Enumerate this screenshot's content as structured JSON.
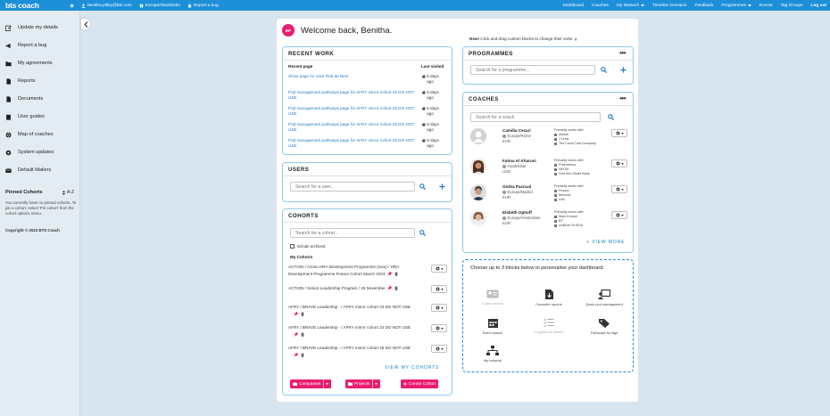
{
  "topbar": {
    "logo_main": "bts",
    "logo_sub": "coach",
    "user_email": "benitha.pilley@bts.com",
    "timezone": "Europe/Stockholm",
    "report_bug": "Report a bug",
    "nav": [
      "Dashboard",
      "Coaches",
      "My Network",
      "Timeline Domains",
      "Feedback",
      "Programmes",
      "Events",
      "Tag Groups"
    ],
    "logout": "Log out"
  },
  "sidebar": {
    "items": [
      {
        "label": "Update my details",
        "icon": "edit-icon"
      },
      {
        "label": "Report a bug",
        "icon": "megaphone-icon"
      },
      {
        "label": "My agreements",
        "icon": "folder-icon"
      },
      {
        "label": "Reports",
        "icon": "document-icon"
      },
      {
        "label": "Documents",
        "icon": "document-icon"
      },
      {
        "label": "User guides",
        "icon": "book-icon"
      },
      {
        "label": "Map of coaches",
        "icon": "globe-icon"
      },
      {
        "label": "System updates",
        "icon": "gear-icon"
      },
      {
        "label": "Default Mailers",
        "icon": "envelope-icon"
      }
    ],
    "pinned_title": "Pinned Cohorts",
    "sort_label": "A-Z",
    "pinned_text": "You currently have no pinned cohorts. To pin a cohort, select 'Pin cohort' from the cohort options menu.",
    "copyright": "Copyright © 2023 BTS Coach"
  },
  "welcome": {
    "initials": "BP",
    "text": "Welcome back, Benitha."
  },
  "new_note": {
    "bold": "New!",
    "text": " Click and drag custom blocks to change their order"
  },
  "recent_work": {
    "title": "RECENT WORK",
    "col_page": "Recent page",
    "col_visited": "Last visited",
    "rows": [
      {
        "page": "Show page for User Rob de Beer",
        "visited": "8 days ago"
      },
      {
        "page": "Pod management pathways page for AFRY mirror cohort 25 DO NOT USE",
        "visited": "9 days ago"
      },
      {
        "page": "Pod management pathways page for AFRY mirror cohort 25 DO NOT USE",
        "visited": "9 days ago"
      },
      {
        "page": "Pod management pathways page for AFRY mirror cohort 25 DO NOT USE",
        "visited": "9 days ago"
      },
      {
        "page": "Pod management pathways page for AFRY mirror cohort 25 DO NOT USE",
        "visited": "9 days ago"
      }
    ]
  },
  "users": {
    "title": "USERS",
    "placeholder": "Search for a user..."
  },
  "cohorts": {
    "title": "COHORTS",
    "placeholder": "Search for a cohort...",
    "include_archived": "Include archived",
    "my_cohorts": "My Cohorts",
    "rows": [
      {
        "name": "ACTION / Action HRA Development Programme (new) / HRA Development Programme France Cohort March 2023"
      },
      {
        "name": "ACTION / Senior Leadership Program / 28 November"
      },
      {
        "name": "AFRY / BRAVE Leadership - / AFRY mirror cohort 23 DO NOT USE"
      },
      {
        "name": "AFRY / BRAVE Leadership - / AFRY mirror cohort 24 DO NOT USE"
      },
      {
        "name": "AFRY / BRAVE Leadership - / AFRY mirror cohort 25 DO NOT USE"
      }
    ],
    "view_link": "VIEW MY COHORTS",
    "btn_companies": "Companies",
    "btn_projects": "Projects",
    "btn_create": "Create Cohort"
  },
  "programmes": {
    "title": "PROGRAMMES",
    "placeholder": "Search for a programme..."
  },
  "coaches": {
    "title": "COACHES",
    "placeholder": "Search for a coach",
    "works_label": "Primarily works with:",
    "rows": [
      {
        "name": "Camilla Cesari",
        "location": "Europe/Rome",
        "currency": "EUR",
        "works": [
          "Abbott",
          "J Crew",
          "The Coca-Cola Company"
        ],
        "avatar": "placeholder"
      },
      {
        "name": "Fatma Al Kharusi",
        "location": "Asia/Dubai",
        "currency": "USD",
        "works": [
          "Pharmerica",
          "NEOM",
          "First Abu Dhabi Bank"
        ],
        "avatar": "photo"
      },
      {
        "name": "Gezka Pascual",
        "location": "Europe/Madrid",
        "currency": "EUR",
        "works": [
          "Repsol",
          "Iberdola",
          "GHL"
        ],
        "avatar": "photo"
      },
      {
        "name": "Elsbeth Ophoff",
        "location": "Europe/Amsterdam",
        "currency": "EUR",
        "works": [
          "Mars Europe",
          "BT",
          "Unilever EUSSA"
        ],
        "avatar": "photo"
      }
    ],
    "view_more": "+ VIEW MORE"
  },
  "personalise": {
    "text": "Choose up to 3 blocks below to personalise your dashboard:",
    "blocks": [
      {
        "label": "Coach search",
        "icon": "id-card-icon",
        "active": false
      },
      {
        "label": "Favourite reports",
        "icon": "file-download-icon",
        "active": true
      },
      {
        "label": "Quick pod management",
        "icon": "presentation-icon",
        "active": true
      },
      {
        "label": "Event search",
        "icon": "calendar-icon",
        "active": true
      },
      {
        "label": "Programme search",
        "icon": "checklist-icon",
        "active": false
      },
      {
        "label": "Pathways by tags",
        "icon": "tag-icon",
        "active": true
      },
      {
        "label": "My network",
        "icon": "network-icon",
        "active": true
      }
    ]
  },
  "colors": {
    "topbar": "#1d8fd9",
    "accent_pink": "#ea1d6f",
    "link_blue": "#1d7fc3",
    "card_border": "#8fcbe8",
    "page_bg": "#d8e5ee"
  }
}
